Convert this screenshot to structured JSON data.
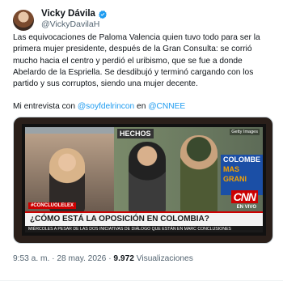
{
  "author": {
    "display_name": "Vicky Dávila",
    "handle": "@VickyDavilaH"
  },
  "post": {
    "paragraph1": "Las equivocaciones de Paloma Valencia quien tuvo todo para ser la primera mujer presidente, después de la Gran Consulta: se corrió mucho hacia el centro y perdió el uribismo, que se fue a donde Abelardo de la Espriella. Se desdibujó y terminó cargando con los partido y sus corruptos, siendo una mujer decente.",
    "p2_prefix": "Mi entrevista con ",
    "p2_mention1": "@soyfdelrincon",
    "p2_middle": " en ",
    "p2_mention2": "@CNNEE"
  },
  "media": {
    "hashtag": "#CONCLUOLELEX",
    "live_label": "EN VIVO",
    "network": "CNN",
    "headline": "¿CÓMO ESTÁ LA OPOSICIÓN EN COLOMBIA?",
    "ticker": "MIÉRCOLES A PESAR DE LAS DOS INICIATIVAS DE DIÁLOGO QUE ESTÁN EN MARC CONCLUSIONES",
    "credit": "Getty Images",
    "sign_text": "HECHOS",
    "poster_line1": "COLOMBE",
    "poster_line2": "MAS",
    "poster_line3": "GRANI"
  },
  "meta": {
    "time": "9:53 a. m.",
    "sep1": " · ",
    "date": "28 may. 2026",
    "sep2": " · ",
    "views_count": "9.972",
    "views_label": " Visualizaciones"
  },
  "colors": {
    "link": "#1d9bf0",
    "verified": "#1d9bf0",
    "cnn_red": "#cc0000"
  }
}
